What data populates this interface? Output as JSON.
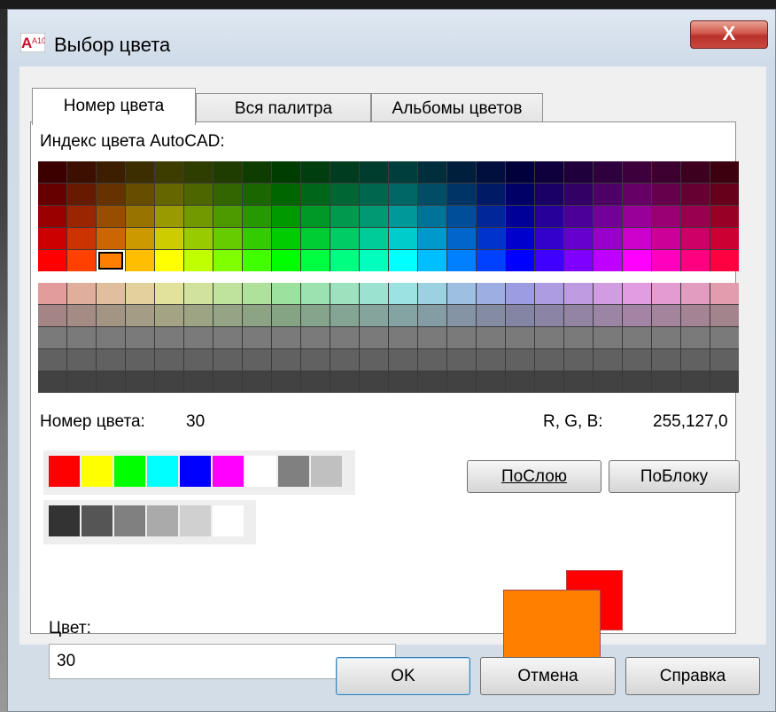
{
  "window": {
    "title": "Выбор цвета",
    "app_icon_text": "A10",
    "close_label": "X"
  },
  "tabs": [
    {
      "label": "Номер цвета",
      "active": true
    },
    {
      "label": "Вся палитра",
      "active": false
    },
    {
      "label": "Альбомы цветов",
      "active": false
    }
  ],
  "index_panel": {
    "heading": "Индекс цвета AutoCAD:",
    "color_number_label": "Номер цвета:",
    "color_number_value": "30",
    "rgb_label": "R, G, B:",
    "rgb_value": "255,127,0"
  },
  "palette": {
    "top_hues": [
      0,
      20,
      40,
      60,
      80,
      100,
      120,
      140,
      160,
      180,
      200,
      220,
      240,
      260,
      280,
      300,
      320,
      340
    ],
    "columns": 24,
    "selected_cell": "orange",
    "standard_colors": [
      "#ff0000",
      "#ffff00",
      "#00ff00",
      "#00ffff",
      "#0000ff",
      "#ff00ff",
      "#ffffff",
      "#808080",
      "#c0c0c0"
    ],
    "gray_colors": [
      "#333333",
      "#555555",
      "#808080",
      "#aaaaaa",
      "#d0d0d0",
      "#ffffff"
    ]
  },
  "buttons": {
    "by_layer": "ПоСлою",
    "by_block": "ПоБлоку",
    "ok": "OK",
    "cancel": "Отмена",
    "help": "Справка"
  },
  "color_field": {
    "label": "Цвет:",
    "value": "30"
  },
  "preview": {
    "old_color": "#ff0000",
    "new_color": "#ff7f00"
  }
}
